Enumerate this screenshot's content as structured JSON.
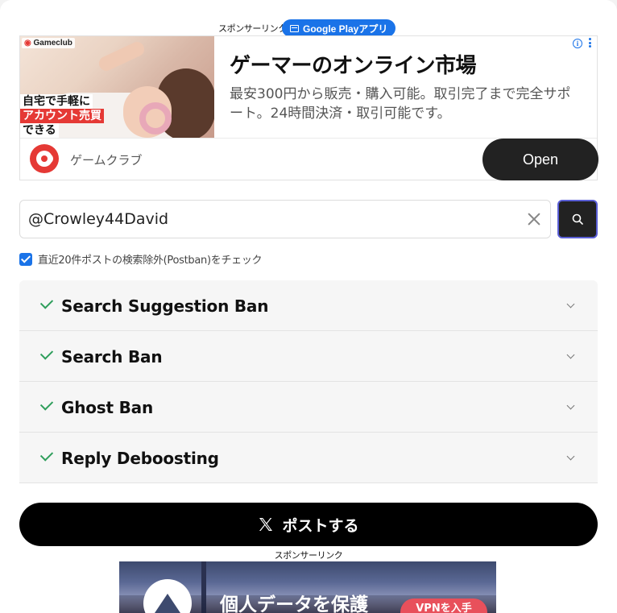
{
  "sponsored_top": {
    "label": "スポンサーリンク",
    "badge": "Google Playアプリ"
  },
  "ad": {
    "brand": "Gameclub",
    "image_text": [
      "自宅で手軽に",
      "アカウント売買",
      "できる"
    ],
    "headline": "ゲーマーのオンライン市場",
    "description": "最安300円から販売・購入可能。取引完了まで完全サポート。24時間決済・取引可能です。",
    "app_name": "ゲームクラブ",
    "open_label": "Open",
    "info_label": "i"
  },
  "search": {
    "value": "@Crowley44David",
    "placeholder": ""
  },
  "options": {
    "postban_check_label": "直近20件ポストの検索除外(Postban)をチェック",
    "postban_checked": true
  },
  "checks": [
    {
      "label": "Search Suggestion Ban",
      "status": "passed"
    },
    {
      "label": "Search Ban",
      "status": "passed"
    },
    {
      "label": "Ghost Ban",
      "status": "passed"
    },
    {
      "label": "Reply Deboosting",
      "status": "passed"
    }
  ],
  "post_button": {
    "label": "ポストする",
    "icon": "x-logo-icon"
  },
  "sponsored_bottom": {
    "label": "スポンサーリンク"
  },
  "vpn_ad": {
    "headline": "個人データを保護",
    "cta": "VPNを入手"
  },
  "colors": {
    "accent_blue": "#1a73e8",
    "check_green": "#2e9e5b",
    "button_black": "#000000",
    "open_button": "#222222"
  }
}
